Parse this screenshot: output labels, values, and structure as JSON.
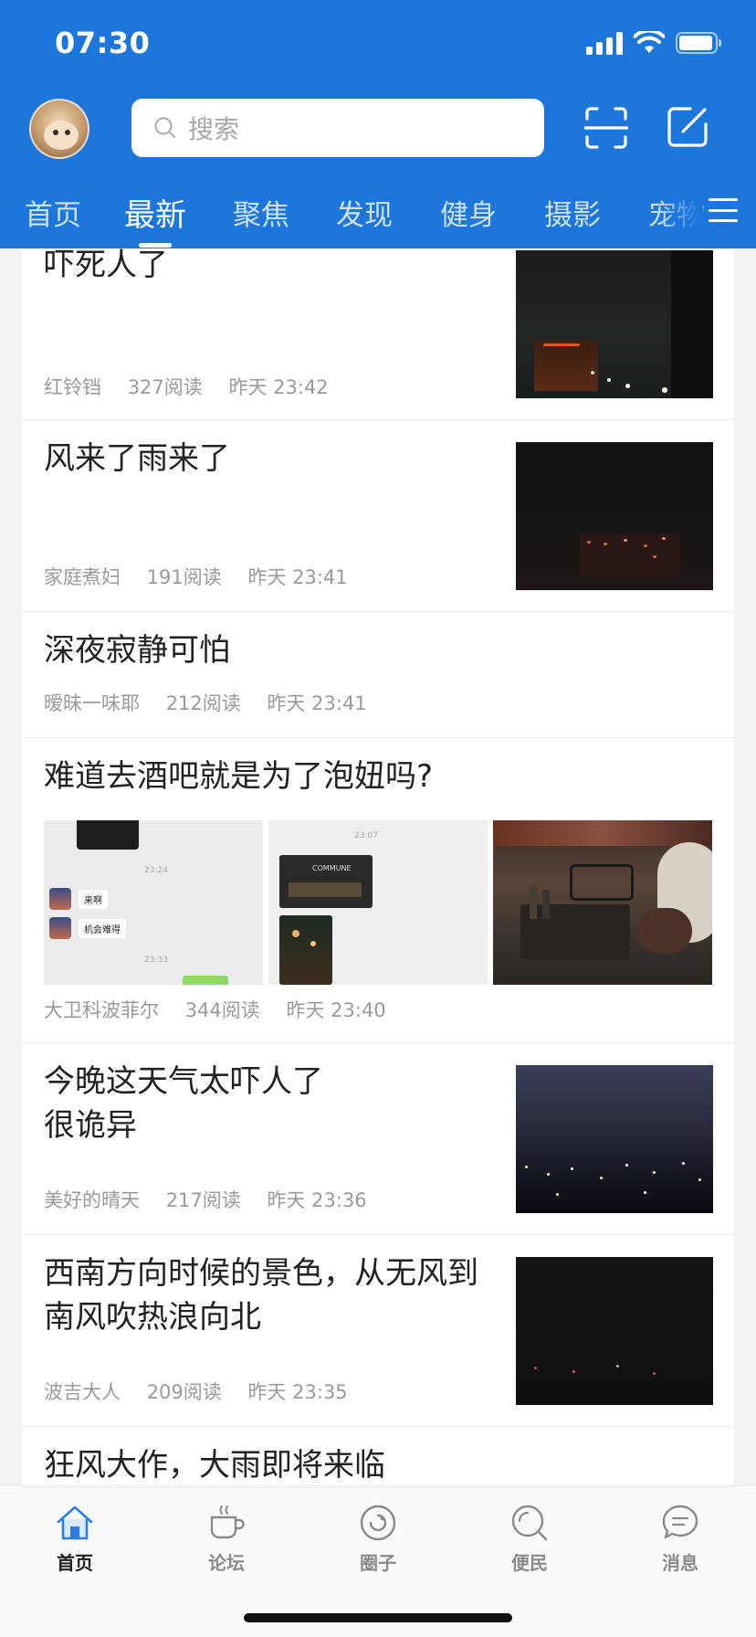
{
  "status_bar": {
    "time": "07:30"
  },
  "header": {
    "search_placeholder": "搜索",
    "tabs": [
      "首页",
      "最新",
      "聚焦",
      "发现",
      "健身",
      "摄影",
      "宠物"
    ],
    "active_tab": "最新",
    "accent_color": "#1d76dc"
  },
  "feed": [
    {
      "title": "吓死人了",
      "author": "红铃铛",
      "reads": "327阅读",
      "time": "昨天 23:42"
    },
    {
      "title": "风来了雨来了",
      "author": "家庭煮妇",
      "reads": "191阅读",
      "time": "昨天 23:41"
    },
    {
      "title": "深夜寂静可怕",
      "author": "暧昧一味耶",
      "reads": "212阅读",
      "time": "昨天 23:41"
    },
    {
      "title": "难道去酒吧就是为了泡妞吗?",
      "author": "大卫科波菲尔",
      "reads": "344阅读",
      "time": "昨天 23:40",
      "image_texts": {
        "chat_time_1": "23:24",
        "chat_msg_1": "来啊",
        "chat_msg_2": "机会难得",
        "chat_time_2": "23:33",
        "chat_time_3": "23:07",
        "sign": "COMMUNE"
      }
    },
    {
      "title_line1": "今晚这天气太吓人了",
      "title_line2": "很诡异",
      "author": "美好的晴天",
      "reads": "217阅读",
      "time": "昨天 23:36"
    },
    {
      "title_line1": "西南方向时候的景色，从无风到",
      "title_line2": "南风吹热浪向北",
      "author": "波吉大人",
      "reads": "209阅读",
      "time": "昨天 23:35"
    },
    {
      "title": "狂风大作，大雨即将来临"
    }
  ],
  "bottom_nav": [
    {
      "label": "首页",
      "icon": "home-icon",
      "active": true
    },
    {
      "label": "论坛",
      "icon": "coffee-cup-icon",
      "active": false
    },
    {
      "label": "圈子",
      "icon": "circle-icon",
      "active": false
    },
    {
      "label": "便民",
      "icon": "search-icon",
      "active": false
    },
    {
      "label": "消息",
      "icon": "chat-bubble-icon",
      "active": false
    }
  ]
}
